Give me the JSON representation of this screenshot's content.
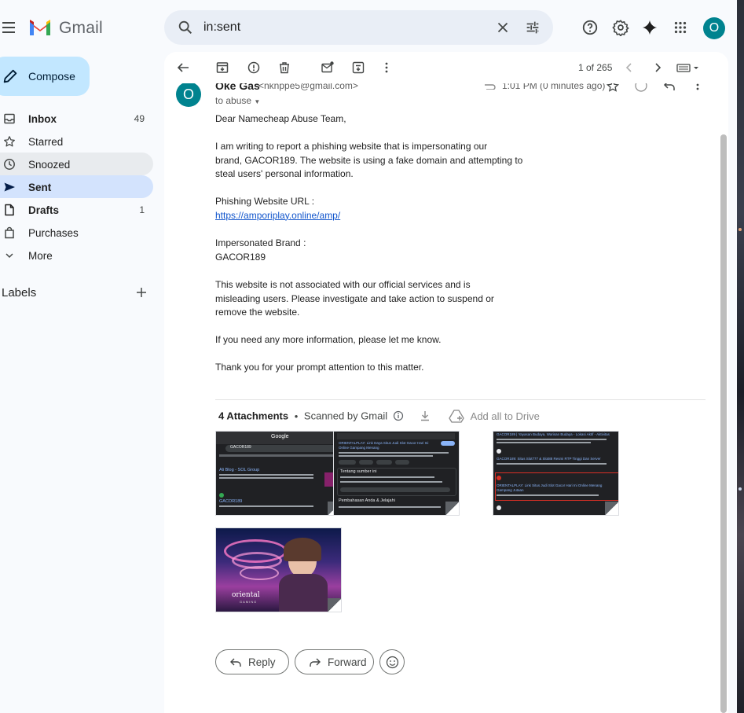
{
  "app": {
    "logo_text": "Gmail"
  },
  "search": {
    "query": "in:sent",
    "clear_icon": "close-icon",
    "options_icon": "tune-icon"
  },
  "account": {
    "initial": "O",
    "color": "#00838f"
  },
  "sidebar": {
    "compose_label": "Compose",
    "items": [
      {
        "label": "Inbox",
        "count": "49",
        "icon": "inbox-icon",
        "bold": true
      },
      {
        "label": "Starred",
        "count": "",
        "icon": "star-icon",
        "bold": false
      },
      {
        "label": "Snoozed",
        "count": "",
        "icon": "clock-icon",
        "bold": false
      },
      {
        "label": "Sent",
        "count": "",
        "icon": "send-icon",
        "bold": true,
        "active": true
      },
      {
        "label": "Drafts",
        "count": "1",
        "icon": "draft-icon",
        "bold": true
      },
      {
        "label": "Purchases",
        "count": "",
        "icon": "bag-icon",
        "bold": false
      },
      {
        "label": "More",
        "count": "",
        "icon": "chevron-down-icon",
        "bold": false
      }
    ],
    "labels_title": "Labels"
  },
  "toolbar": {
    "pagination": "1 of 265"
  },
  "email": {
    "sender_initial": "O",
    "sender_name": "Oke Gas",
    "sender_email": "<nknppe5@gmail.com>",
    "time": "1:01 PM (0 minutes ago)",
    "to_line": "to abuse",
    "greeting": "Dear Namecheap Abuse Team,",
    "para1_line1": "I am writing to report a phishing website that is impersonating our",
    "para1_line2": "brand, GACOR189. The website is using a fake domain and attempting to",
    "para1_line3": "steal users' personal information.",
    "url_label": "Phishing Website URL :",
    "url": "https://amporiplay.online/amp/",
    "brand_label": "Impersonated Brand :",
    "brand": "GACOR189",
    "para2_line1": "This website is not associated with our official services and is",
    "para2_line2": "misleading users. Please investigate and take action to suspend or",
    "para2_line3": "remove the website.",
    "para3": "If you need any more information, please let me know.",
    "para4": "Thank you for your prompt attention to this matter."
  },
  "attachments": {
    "count_label": "4 Attachments",
    "separator": "•",
    "scanned_label": "Scanned by Gmail",
    "drive_label": "Add all to Drive",
    "thumb1_brand": "Google",
    "thumb1_query": "GACOR189",
    "thumb1_result1": "Ali Blog - SOL Group",
    "thumb1_result2": "GACOR189",
    "thumb2_title": "ORIENTALPLAY: Link Daya Situs Judi Slot Gacor Hari Ini Online Gampang Menang",
    "thumb2_heading": "Tentang sumber ini",
    "thumb2_section": "Pembahasan Anda & Jelajahi",
    "thumb3_result1": "GACOR189 | Yayasan Budaya, Warisan Budaya - Lokasi Aktif - Aktivitas Lan Blog",
    "thumb3_result2": "GACOR189: Situs Slot777 & Slot88 Resmi RTP Tinggi Dan Server Thailand",
    "thumb3_result3": "ORIENTALPLAY: Link Situs Judi Slot Gacor Hari Ini Online Menang Gampang Jutaan",
    "thumb4_caption": "oriental",
    "thumb4_subcaption": "GAMING"
  },
  "actions": {
    "reply_label": "Reply",
    "forward_label": "Forward"
  }
}
